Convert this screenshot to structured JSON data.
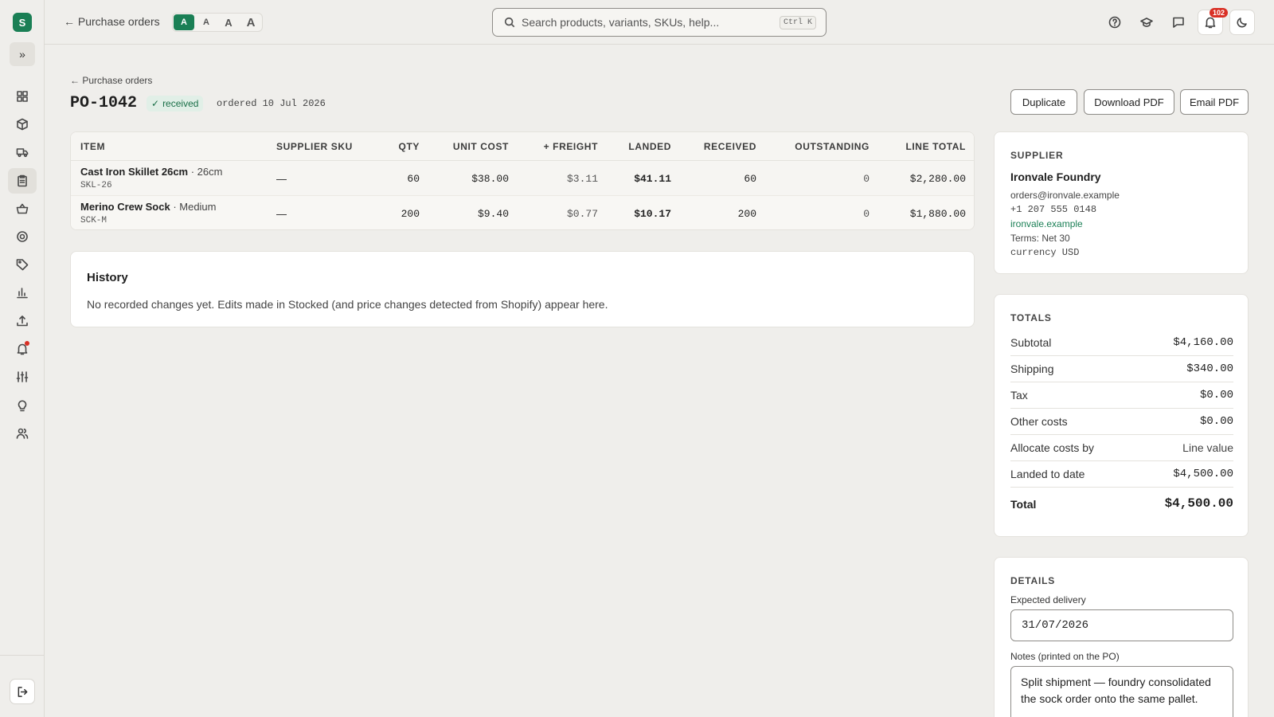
{
  "app": {
    "logo_letter": "S"
  },
  "topbar": {
    "back_label": "← Purchase orders",
    "font_sizes": [
      "A",
      "A",
      "A",
      "A"
    ],
    "search_placeholder": "Search products, variants, SKUs, help...",
    "search_shortcut": "Ctrl K",
    "notification_count": "102"
  },
  "page": {
    "breadcrumb": "← Purchase orders",
    "po_number": "PO-1042",
    "status": "received",
    "ordered_date": "ordered 10 Jul 2026",
    "buttons": {
      "duplicate": "Duplicate",
      "download_pdf": "Download PDF",
      "email_pdf": "Email PDF"
    }
  },
  "items_table": {
    "columns": [
      "ITEM",
      "SUPPLIER SKU",
      "QTY",
      "UNIT COST",
      "+ FREIGHT",
      "LANDED",
      "RECEIVED",
      "OUTSTANDING",
      "LINE TOTAL"
    ],
    "rows": [
      {
        "name": "Cast Iron Skillet 26cm",
        "variant": " · 26cm",
        "sku": "SKL-26",
        "supplier_sku": "—",
        "qty": "60",
        "unit_cost": "$38.00",
        "freight": "$3.11",
        "landed": "$41.11",
        "received": "60",
        "outstanding": "0",
        "line_total": "$2,280.00"
      },
      {
        "name": "Merino Crew Sock",
        "variant": " · Medium",
        "sku": "SCK-M",
        "supplier_sku": "—",
        "qty": "200",
        "unit_cost": "$9.40",
        "freight": "$0.77",
        "landed": "$10.17",
        "received": "200",
        "outstanding": "0",
        "line_total": "$1,880.00"
      }
    ]
  },
  "history": {
    "title": "History",
    "empty_text": "No recorded changes yet. Edits made in Stocked (and price changes detected from Shopify) appear here."
  },
  "supplier": {
    "title": "SUPPLIER",
    "name": "Ironvale Foundry",
    "email": "orders@ironvale.example",
    "phone": "+1 207 555 0148",
    "website": "ironvale.example",
    "terms": "Terms: Net 30",
    "currency": "currency USD"
  },
  "totals": {
    "title": "TOTALS",
    "rows": [
      {
        "label": "Subtotal",
        "value": "$4,160.00"
      },
      {
        "label": "Shipping",
        "value": "$340.00"
      },
      {
        "label": "Tax",
        "value": "$0.00"
      },
      {
        "label": "Other costs",
        "value": "$0.00"
      },
      {
        "label": "Allocate costs by",
        "value": "Line value"
      },
      {
        "label": "Landed to date",
        "value": "$4,500.00"
      }
    ],
    "total_label": "Total",
    "total_value": "$4,500.00"
  },
  "details": {
    "title": "DETAILS",
    "expected_delivery_label": "Expected delivery",
    "expected_delivery_value": "31/07/2026",
    "notes_label": "Notes (printed on the PO)",
    "notes_value": "Split shipment — foundry consolidated the sock order onto the same pallet."
  },
  "colors": {
    "accent": "#1a7f55",
    "badge": "#d93025",
    "background": "#efeeeb"
  }
}
